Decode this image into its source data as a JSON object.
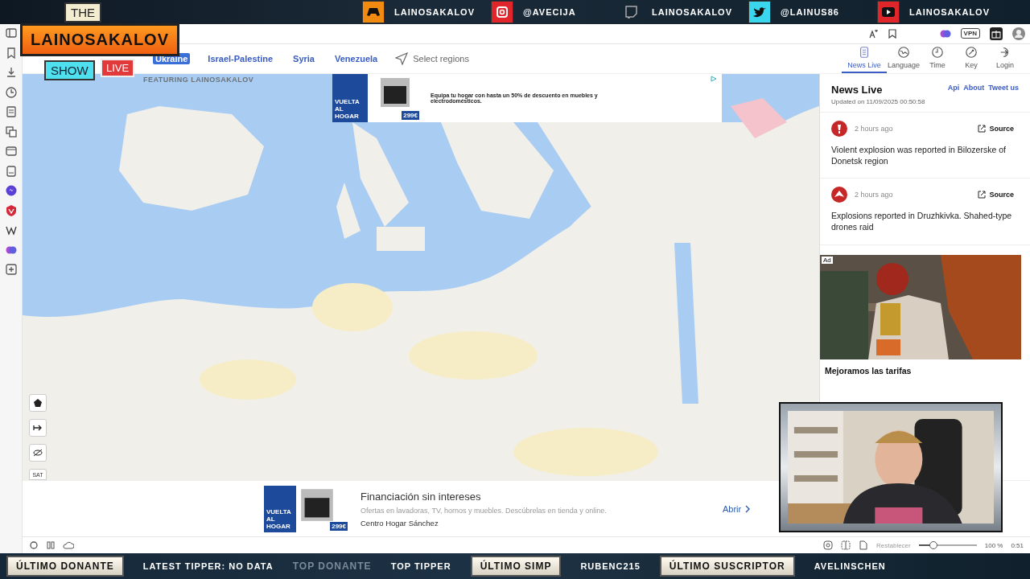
{
  "stream_top": {
    "logo": {
      "the": "THE",
      "name": "LAINOSAKALOV",
      "show": "SHOW",
      "live": "LIVE",
      "featuring": "FEATURING LAINOSAKALOV"
    },
    "socials": [
      {
        "kind": "gamepad",
        "handle": "LAINOSAKALOV"
      },
      {
        "kind": "camera",
        "handle": "@AVECIJA"
      },
      {
        "kind": "chat",
        "handle": "LAINOSAKALOV"
      },
      {
        "kind": "bird",
        "handle": "@LAINUS86"
      },
      {
        "kind": "play",
        "handle": "LAINOSAKALOV"
      }
    ]
  },
  "toolbar": {
    "vpn": "VPN"
  },
  "site": {
    "regions": [
      {
        "label": "Ukraine",
        "selected": true
      },
      {
        "label": "Israel-Palestine",
        "selected": false
      },
      {
        "label": "Syria",
        "selected": false
      },
      {
        "label": "Venezuela",
        "selected": false
      }
    ],
    "select_regions": "Select regions",
    "nav": [
      {
        "kind": "news",
        "label": "News Live",
        "selected": true
      },
      {
        "kind": "language",
        "label": "Language",
        "selected": false
      },
      {
        "kind": "time",
        "label": "Time",
        "selected": false
      },
      {
        "kind": "key",
        "label": "Key",
        "selected": false
      },
      {
        "kind": "login",
        "label": "Login",
        "selected": false
      }
    ]
  },
  "map": {
    "ad_text": "Equipa tu hogar con hasta un 50% de descuento en muebles y electrodomésticos.",
    "ad_price": "299€",
    "ad_brand": "VUELTA AL HOGAR",
    "sat": "SAT"
  },
  "news": {
    "title": "News Live",
    "links": [
      "Api",
      "About",
      "Tweet us"
    ],
    "updated": "Updated on 11/09/2025 00:50:58",
    "items": [
      {
        "kind": "explosion",
        "time": "2 hours ago",
        "source": "Source",
        "text": "Violent explosion was reported in Bilozerske of Donetsk region"
      },
      {
        "kind": "drone",
        "time": "2 hours ago",
        "source": "Source",
        "text": "Explosions reported in Druzhkivka. Shahed-type drones raid"
      }
    ]
  },
  "side_ad": {
    "badge": "Ad",
    "title": "Mejoramos las tarifas"
  },
  "bottom_ad": {
    "brand": "VUELTA AL HOGAR",
    "price": "299€",
    "title": "Financiación sin intereses",
    "text": "Ofertas en lavadoras, TV, hornos y muebles. Descúbrelas en tienda y online.",
    "advertiser": "Centro Hogar Sánchez",
    "button": "Abrir"
  },
  "status_bar": {
    "reset": "Restablecer",
    "zoom": {
      "level": 0.25
    },
    "zoom_text": "100 %",
    "time": "0:51"
  },
  "stream_bottom": [
    {
      "kind": "label",
      "text": "ÚLTIMO DONANTE"
    },
    {
      "kind": "value",
      "text": "LATEST TIPPER: NO DATA"
    },
    {
      "kind": "dim",
      "text": "TOP DONANTE"
    },
    {
      "kind": "value",
      "text": "TOP TIPPER"
    },
    {
      "kind": "label",
      "text": "ÚLTIMO SIMP"
    },
    {
      "kind": "value",
      "text": "RUBENC215"
    },
    {
      "kind": "label",
      "text": "ÚLTIMO SUSCRIPTOR"
    },
    {
      "kind": "value",
      "text": "AVELINSCHEN"
    }
  ]
}
